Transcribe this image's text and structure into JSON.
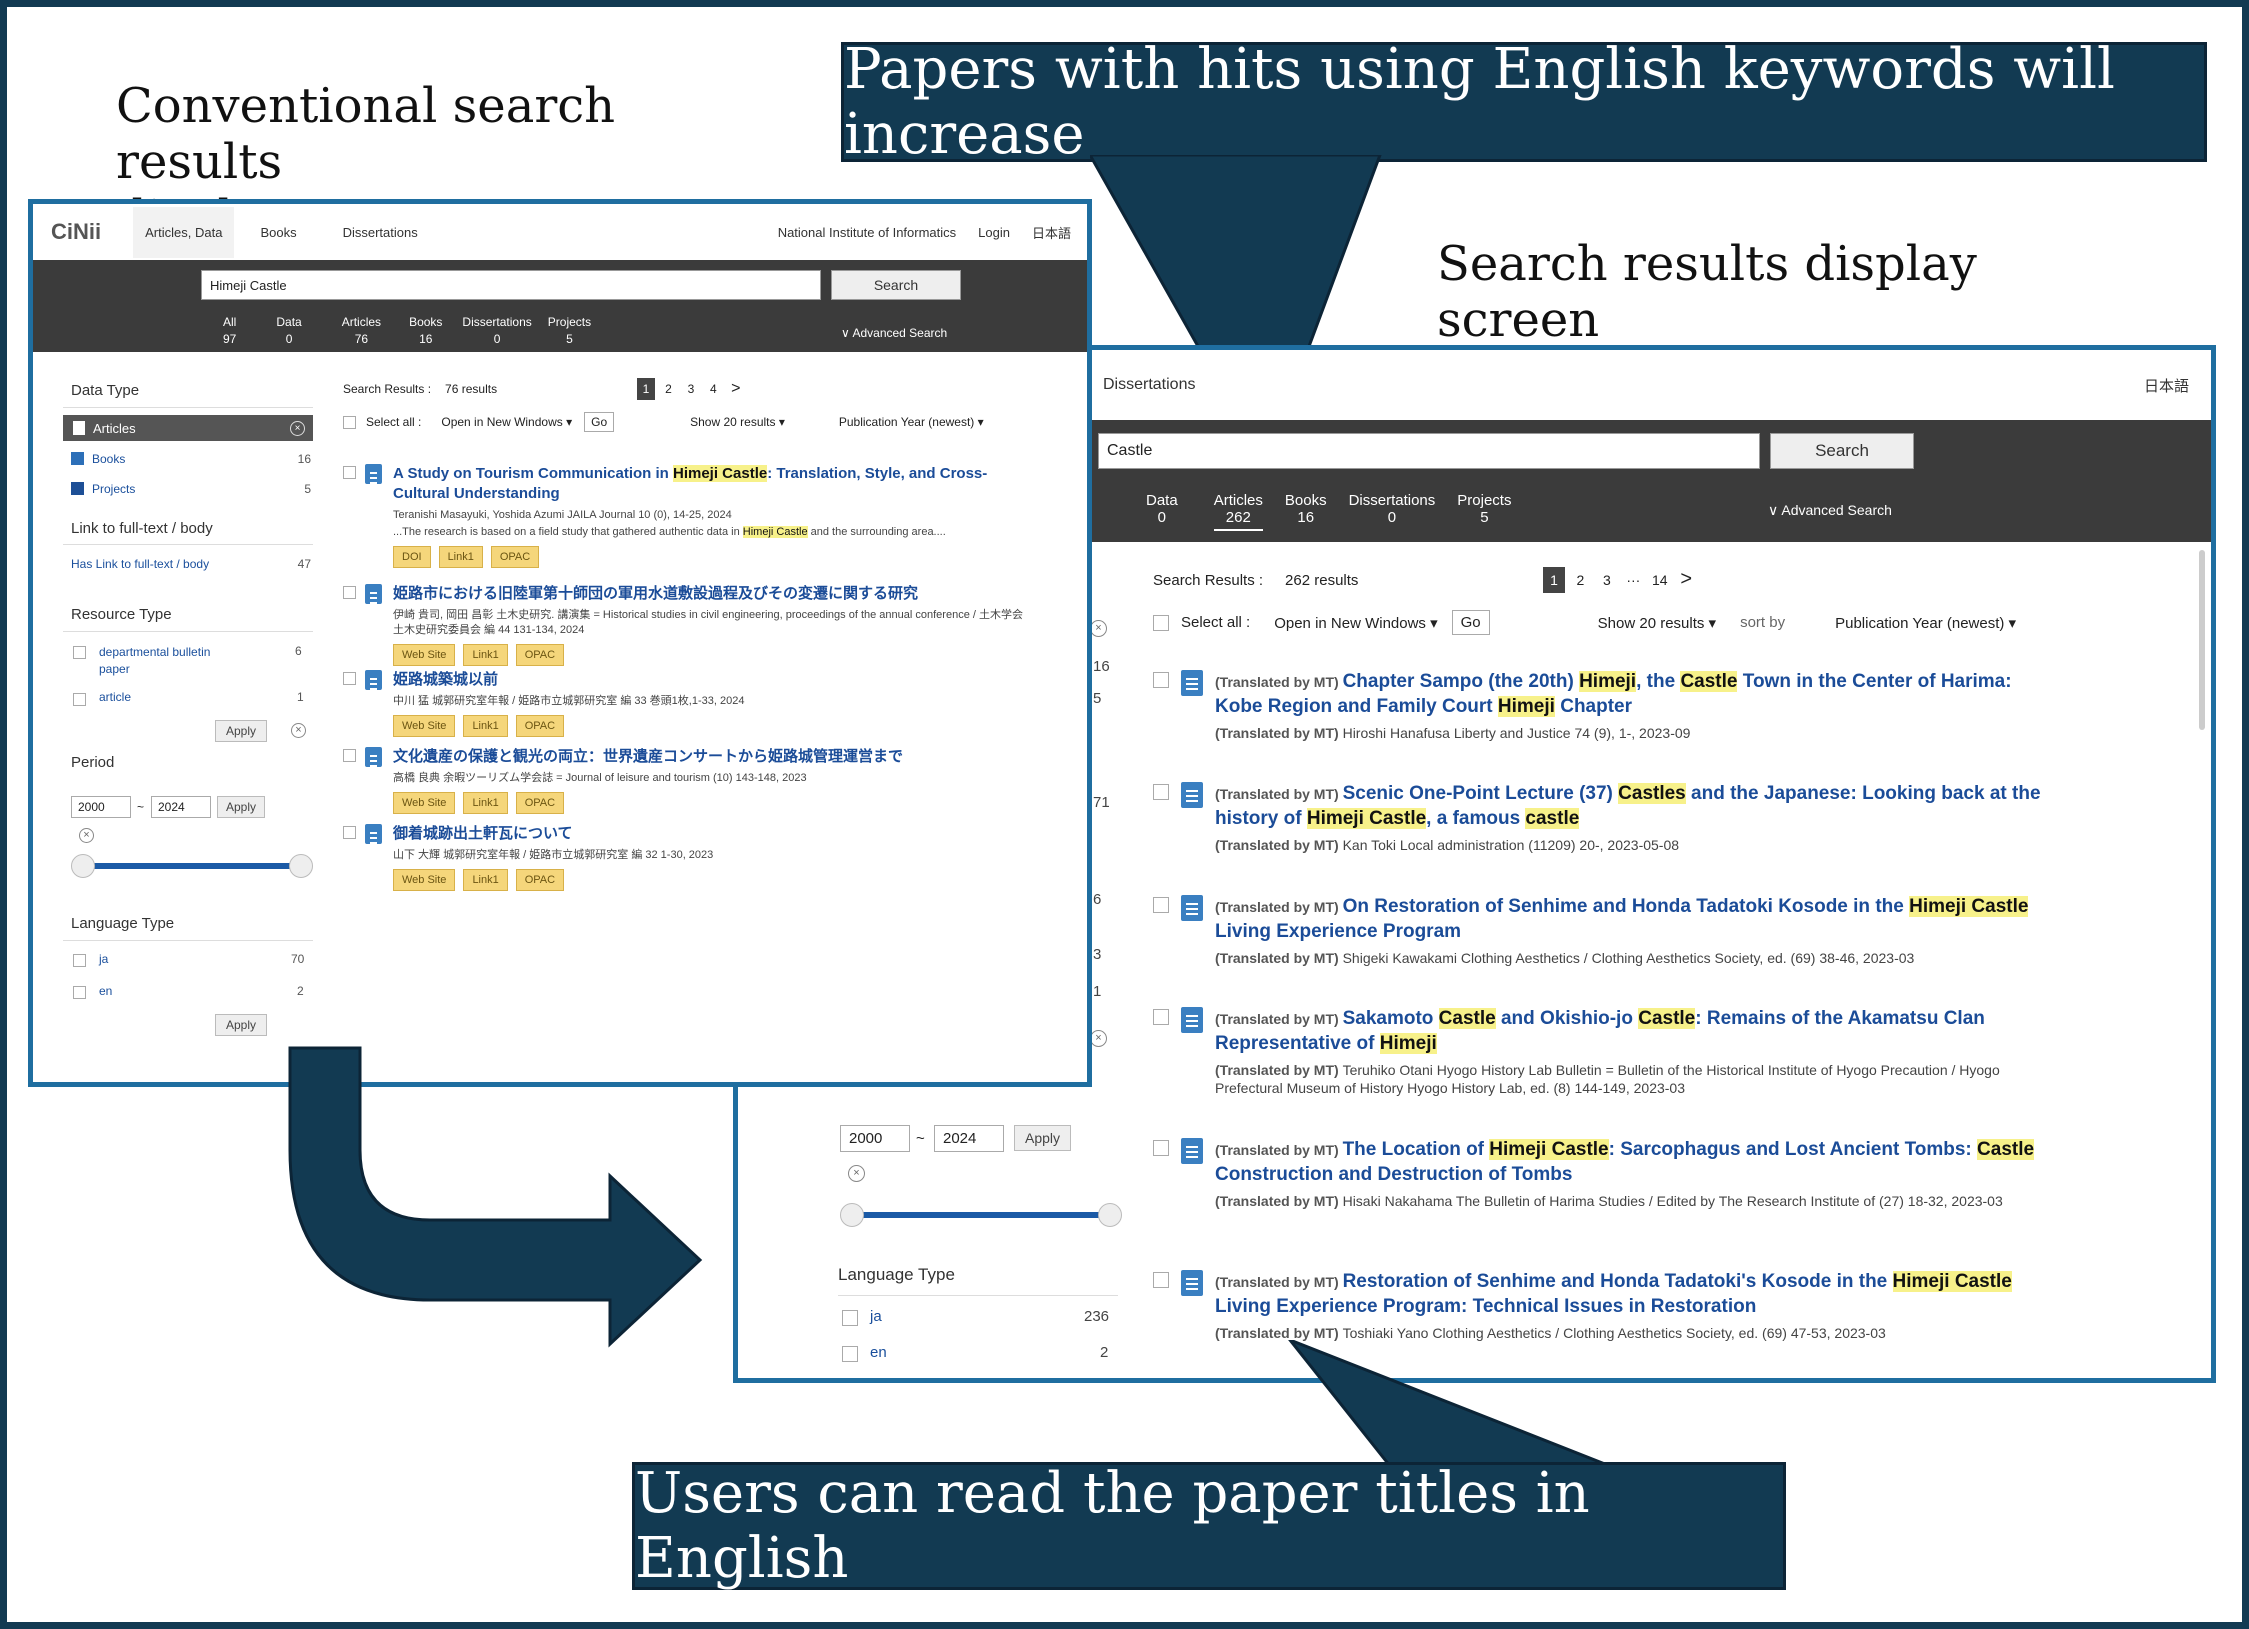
{
  "captions": {
    "conventional": "Conventional search results\ndisplay screen",
    "translated": "Search results display screen\nwith translation function"
  },
  "banners": {
    "top": "Papers with hits using English keywords will increase",
    "bottom": "Users can read the paper titles in English"
  },
  "colors": {
    "banner": "#123a52",
    "highlight": "#f7f18a",
    "link": "#1b4c98",
    "tag": "#f5d67b"
  },
  "left": {
    "logo": "CiNii",
    "nav": [
      "Articles, Data",
      "Books",
      "Dissertations"
    ],
    "nav_right": [
      "National Institute of Informatics",
      "Login",
      "日本語"
    ],
    "search_value": "Himeji Castle",
    "search_button": "Search",
    "tabs": [
      {
        "label": "All",
        "count": "97"
      },
      {
        "label": "Data",
        "count": "0"
      },
      {
        "label": "Articles",
        "count": "76"
      },
      {
        "label": "Books",
        "count": "16"
      },
      {
        "label": "Dissertations",
        "count": "0"
      },
      {
        "label": "Projects",
        "count": "5"
      }
    ],
    "advanced": "Advanced Search",
    "data_type_title": "Data Type",
    "data_types": [
      {
        "label": "Articles",
        "count": ""
      },
      {
        "label": "Books",
        "count": "16"
      },
      {
        "label": "Projects",
        "count": "5"
      }
    ],
    "fulltext_title": "Link to full-text / body",
    "fulltext_item": {
      "label": "Has Link to full-text / body",
      "count": "47"
    },
    "resource_title": "Resource Type",
    "resources": [
      {
        "label": "departmental bulletin paper",
        "count": "6"
      },
      {
        "label": "article",
        "count": "1"
      }
    ],
    "apply": "Apply",
    "period_title": "Period",
    "period_from": "2000",
    "period_sep": "~",
    "period_to": "2024",
    "language_title": "Language Type",
    "languages": [
      {
        "label": "ja",
        "count": "70"
      },
      {
        "label": "en",
        "count": "2"
      }
    ],
    "results_label": "Search Results :",
    "results_count": "76 results",
    "pages": [
      "1",
      "2",
      "3",
      "4",
      ">"
    ],
    "select_all": "Select all :",
    "open_new": "Open in New Windows",
    "go": "Go",
    "show": "Show 20 results",
    "sort": "Publication Year (newest)",
    "results": [
      {
        "title": [
          "A Study on Tourism Communication in ",
          "Himeji Castle",
          ": Translation, Style, and Cross-Cultural Understanding"
        ],
        "meta": "Teranishi Masayuki, Yoshida Azumi JAILA Journal 10 (0), 14-25, 2024",
        "snippet": [
          "...The research is based on a field study that gathered authentic data in ",
          "Himeji Castle",
          " and the surrounding area...."
        ],
        "tags": [
          "DOI",
          "Link1",
          "OPAC"
        ]
      },
      {
        "title": [
          "姫路市における旧陸軍第十師団の軍用水道敷設過程及びその変遷に関する研究"
        ],
        "meta": "伊崎 貴司, 岡田 昌彰 土木史研究. 講演集 = Historical studies in civil engineering, proceedings of the annual conference / 土木学会土木史研究委員会 編 44 131-134, 2024",
        "snippet": [],
        "tags": [
          "Web Site",
          "Link1",
          "OPAC"
        ]
      },
      {
        "title": [
          "姫路城築城以前"
        ],
        "meta": "中川 猛 城郭研究室年報 / 姫路市立城郭研究室 編 33 巻頭1枚,1-33, 2024",
        "snippet": [],
        "tags": [
          "Web Site",
          "Link1",
          "OPAC"
        ]
      },
      {
        "title": [
          "文化遺産の保護と観光の両立：世界遺産コンサートから姫路城管理運営まで"
        ],
        "meta": "高橋 良典 余暇ツーリズム学会誌 = Journal of leisure and tourism (10) 143-148, 2023",
        "snippet": [],
        "tags": [
          "Web Site",
          "Link1",
          "OPAC"
        ]
      },
      {
        "title": [
          "御着城跡出土軒瓦について"
        ],
        "meta": "山下 大輝 城郭研究室年報 / 姫路市立城郭研究室 編 32 1-30, 2023",
        "snippet": [],
        "tags": [
          "Web Site",
          "Link1",
          "OPAC"
        ]
      }
    ]
  },
  "right": {
    "nav_partial": "Dissertations",
    "lang": "日本語",
    "search_value": "Castle",
    "search_button": "Search",
    "tabs": [
      {
        "label": "Data",
        "count": "0"
      },
      {
        "label": "Articles",
        "count": "262"
      },
      {
        "label": "Books",
        "count": "16"
      },
      {
        "label": "Dissertations",
        "count": "0"
      },
      {
        "label": "Projects",
        "count": "5"
      }
    ],
    "advanced": "Advanced Search",
    "side_counts": [
      "16",
      "5",
      "71",
      "6",
      "3",
      "1"
    ],
    "period_from": "2000",
    "period_sep": "~",
    "period_to": "2024",
    "apply": "Apply",
    "language_title": "Language Type",
    "languages": [
      {
        "label": "ja",
        "count": "236"
      },
      {
        "label": "en",
        "count": "2"
      }
    ],
    "results_label": "Search Results :",
    "results_count": "262 results",
    "pages": [
      "1",
      "2",
      "3",
      "···",
      "14",
      ">"
    ],
    "select_all": "Select all :",
    "open_new": "Open in New Windows",
    "go": "Go",
    "show": "Show 20 results",
    "sort_by": "sort by",
    "sort": "Publication Year (newest)",
    "translated_tag": "(Translated by MT)",
    "results": [
      {
        "title": [
          "Chapter Sampo (the 20th) ",
          "Himeji",
          ", the ",
          "Castle",
          " Town in the Center of Harima: Kobe Region and Family Court ",
          "Himeji",
          " Chapter"
        ],
        "meta": "Hiroshi Hanafusa Liberty and Justice 74 (9), 1-, 2023-09"
      },
      {
        "title": [
          "Scenic One-Point Lecture (37) ",
          "Castles",
          " and the Japanese: Looking back at the history of ",
          "Himeji Castle",
          ", a famous ",
          "castle"
        ],
        "meta": "Kan Toki Local administration (11209) 20-, 2023-05-08"
      },
      {
        "title": [
          "On Restoration of Senhime and Honda Tadatoki Kosode in the ",
          "Himeji Castle",
          " Living Experience Program"
        ],
        "meta": "Shigeki Kawakami Clothing Aesthetics / Clothing Aesthetics Society, ed. (69) 38-46, 2023-03"
      },
      {
        "title": [
          "Sakamoto ",
          "Castle",
          " and Okishio-jo ",
          "Castle",
          ": Remains of the Akamatsu Clan Representative of ",
          "Himeji"
        ],
        "meta": "Teruhiko Otani Hyogo History Lab Bulletin = Bulletin of the Historical Institute of Hyogo Precaution / Hyogo Prefectural Museum of History Hyogo History Lab, ed. (8) 144-149, 2023-03"
      },
      {
        "title": [
          "The Location of ",
          "Himeji Castle",
          ": Sarcophagus and Lost Ancient Tombs: ",
          "Castle",
          " Construction and Destruction of Tombs"
        ],
        "meta": "Hisaki Nakahama The Bulletin of Harima Studies / Edited by The Research Institute of (27) 18-32, 2023-03"
      },
      {
        "title": [
          "Restoration of Senhime and Honda Tadatoki's Kosode in the ",
          "Himeji Castle",
          " Living Experience Program: Technical Issues in Restoration"
        ],
        "meta": "Toshiaki Yano Clothing Aesthetics / Clothing Aesthetics Society, ed. (69) 47-53, 2023-03"
      }
    ]
  }
}
